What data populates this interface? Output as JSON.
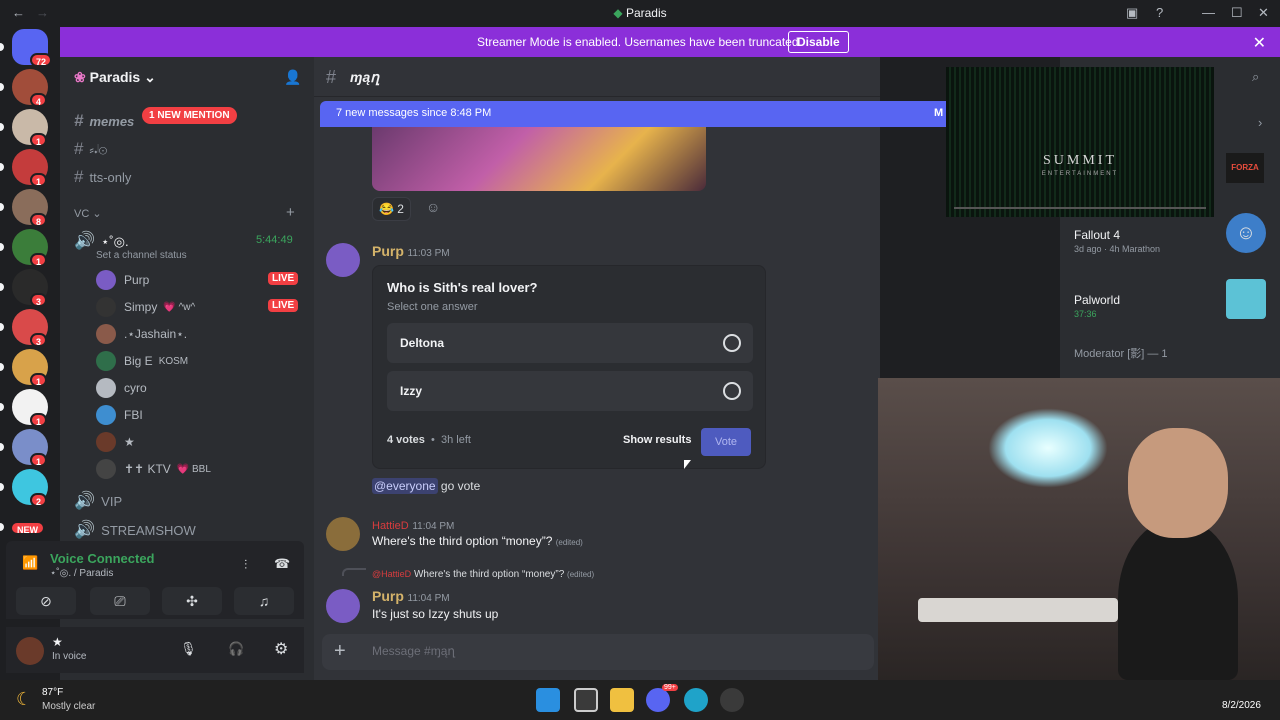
{
  "window": {
    "title": "Paradis"
  },
  "servers": [
    {
      "badge": "72",
      "color": "#313338"
    },
    {
      "badge": "4",
      "color": "#a14d3a"
    },
    {
      "badge": "1",
      "color": "#c9b9a8"
    },
    {
      "badge": "1",
      "color": "#c43c3c"
    },
    {
      "badge": "8",
      "color": "#8a6d5b"
    },
    {
      "badge": "1",
      "color": "#3b7d3a"
    },
    {
      "badge": "3",
      "color": "#2a2a2a"
    },
    {
      "badge": "3",
      "color": "#d94a4a"
    },
    {
      "badge": "1",
      "color": "#d8a24a"
    },
    {
      "badge": "1",
      "color": "#f2f2f2"
    },
    {
      "badge": "1",
      "color": "#7a8ec9"
    },
    {
      "badge": "2",
      "color": "#3ec6e0"
    },
    {
      "badge": "NEW",
      "color": "#2b2d31"
    }
  ],
  "banner": {
    "text": "Streamer Mode is enabled. Usernames have been truncated.",
    "button": "Disable"
  },
  "sidebar": {
    "server_name": "Paradis",
    "mention_pill": "1 NEW MENTION",
    "channels": [
      "memes",
      "⸗𝆺𝅥⊙",
      "tts-only"
    ],
    "vc_label": "VC",
    "voice_channel": {
      "name": "⋆˚◎.",
      "timer": "5:44:49",
      "status": "Set a channel status"
    },
    "voice_users": [
      {
        "name": "Purp",
        "tag": "LIVE",
        "color": "#7a5cc4"
      },
      {
        "name": "Simpy",
        "suffix": "💗 ^w^",
        "tag": "LIVE",
        "color": "#333"
      },
      {
        "name": ".⋆Jashain⋆.",
        "color": "#8a5a4a"
      },
      {
        "name": "Big E",
        "suffix": "KOSM",
        "color": "#2f6e4a"
      },
      {
        "name": "cyro",
        "color": "#b5bac1"
      },
      {
        "name": "FBI",
        "color": "#3e8ed0"
      },
      {
        "name": "★",
        "color": "#6a3a2a"
      },
      {
        "name": "✝✝ KTV",
        "suffix": "💗 BBL",
        "color": "#444"
      }
    ],
    "more_channels": [
      "VIP",
      "STREAMSHOW"
    ]
  },
  "voice_panel": {
    "status": "Voice Connected",
    "channel": "⋆˚◎. / Paradis"
  },
  "user_panel": {
    "name": "★",
    "status": "In voice"
  },
  "chat": {
    "channel": "ɱąղ",
    "new_messages": "7 new messages since 8:48 PM",
    "new_messages_right": "M",
    "reaction_count": "2",
    "poll_message": {
      "author": "Purp",
      "time": "11:03 PM",
      "question": "Who is Sith's real lover?",
      "hint": "Select one answer",
      "options": [
        "Deltona",
        "Izzy"
      ],
      "votes": "4 votes",
      "time_left": "3h left",
      "show_results": "Show results",
      "vote": "Vote"
    },
    "everyone": "@everyone",
    "everyone_text": "go vote",
    "msg2": {
      "author": "HattieD",
      "time": "11:04 PM",
      "text": "Where's  the third option “money”?",
      "edited": "(edited)"
    },
    "msg3": {
      "reply_author": "@HattieD",
      "reply_text": "Where's  the third option “money”?",
      "reply_edited": "(edited)",
      "author": "Purp",
      "time": "11:04 PM",
      "text": "It's just so Izzy shuts up"
    },
    "composer_placeholder": "Message #ɱąղ"
  },
  "right": {
    "activities": [
      {
        "title": "Fallout 4",
        "sub": "3d ago",
        "sub2": "4h Marathon"
      },
      {
        "title": "Palworld",
        "sub": "37:36"
      }
    ],
    "moderator": "Moderator [影] — 1"
  },
  "mini_video": {
    "logo": "SUMMIT",
    "sub": "ENTERTAINMENT"
  },
  "taskbar": {
    "weather_temp": "87°F",
    "weather_desc": "Mostly clear",
    "date": "8/2/2026",
    "discord_badge": "99+"
  }
}
